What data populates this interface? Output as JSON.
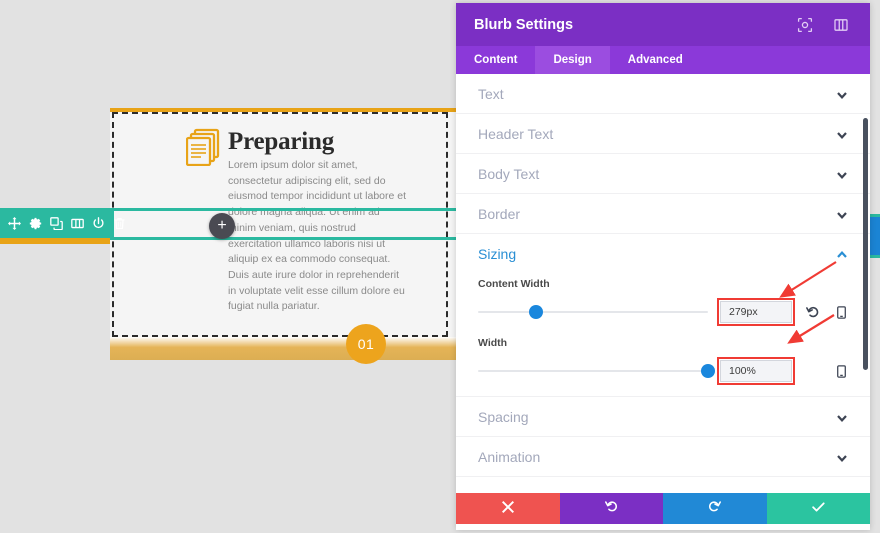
{
  "canvas": {
    "blurb": {
      "title": "Preparing",
      "icon_name": "documents-icon",
      "body": "Lorem ipsum dolor sit amet, consectetur adipiscing elit, sed do eiusmod tempor incididunt ut labore et dolore magna aliqua. Ut enim ad minim veniam, quis nostrud exercitation ullamco laboris nisi ut aliquip ex ea commodo consequat. Duis aute irure dolor in reprehenderit in voluptate velit esse cillum dolore eu fugiat nulla pariatur.",
      "badge": "01"
    },
    "module_toolbar": {
      "icons": [
        "move-icon",
        "gear-icon",
        "duplicate-icon",
        "columns-icon",
        "power-icon",
        "trash-icon"
      ],
      "color": "#2bb9a0"
    },
    "add_button_label": "+",
    "accent_orange": "#e8a317"
  },
  "panel": {
    "title": "Blurb Settings",
    "header_icons": [
      "focus-icon",
      "layout-icon"
    ],
    "tabs": [
      {
        "label": "Content",
        "active": false
      },
      {
        "label": "Design",
        "active": true
      },
      {
        "label": "Advanced",
        "active": false
      }
    ],
    "sections": [
      {
        "label": "Text",
        "expanded": false
      },
      {
        "label": "Header Text",
        "expanded": false
      },
      {
        "label": "Body Text",
        "expanded": false
      },
      {
        "label": "Border",
        "expanded": false
      }
    ],
    "sizing": {
      "label": "Sizing",
      "expanded": true,
      "fields": [
        {
          "label": "Content Width",
          "value": "279px",
          "slider_percent": 25,
          "has_reset": true,
          "has_device": true,
          "highlighted": true
        },
        {
          "label": "Width",
          "value": "100%",
          "slider_percent": 100,
          "has_reset": false,
          "has_device": true,
          "highlighted": true
        }
      ]
    },
    "sections_after": [
      {
        "label": "Spacing",
        "expanded": false
      },
      {
        "label": "Animation",
        "expanded": false
      }
    ],
    "footer": [
      {
        "name": "cancel",
        "icon": "close-icon",
        "color": "#ef5350"
      },
      {
        "name": "undo",
        "icon": "undo-icon",
        "color": "#7b2fc4"
      },
      {
        "name": "redo",
        "icon": "redo-icon",
        "color": "#2189d6"
      },
      {
        "name": "save",
        "icon": "check-icon",
        "color": "#2bc4a0"
      }
    ],
    "colors": {
      "header": "#7b2fc4",
      "tabbar": "#8b39d9",
      "tab_active": "#9b4de0",
      "section_label": "#a3a8bb",
      "sizing_label": "#2a8fd4",
      "slider_handle": "#1a87dd",
      "annotation": "#f03b34"
    }
  }
}
